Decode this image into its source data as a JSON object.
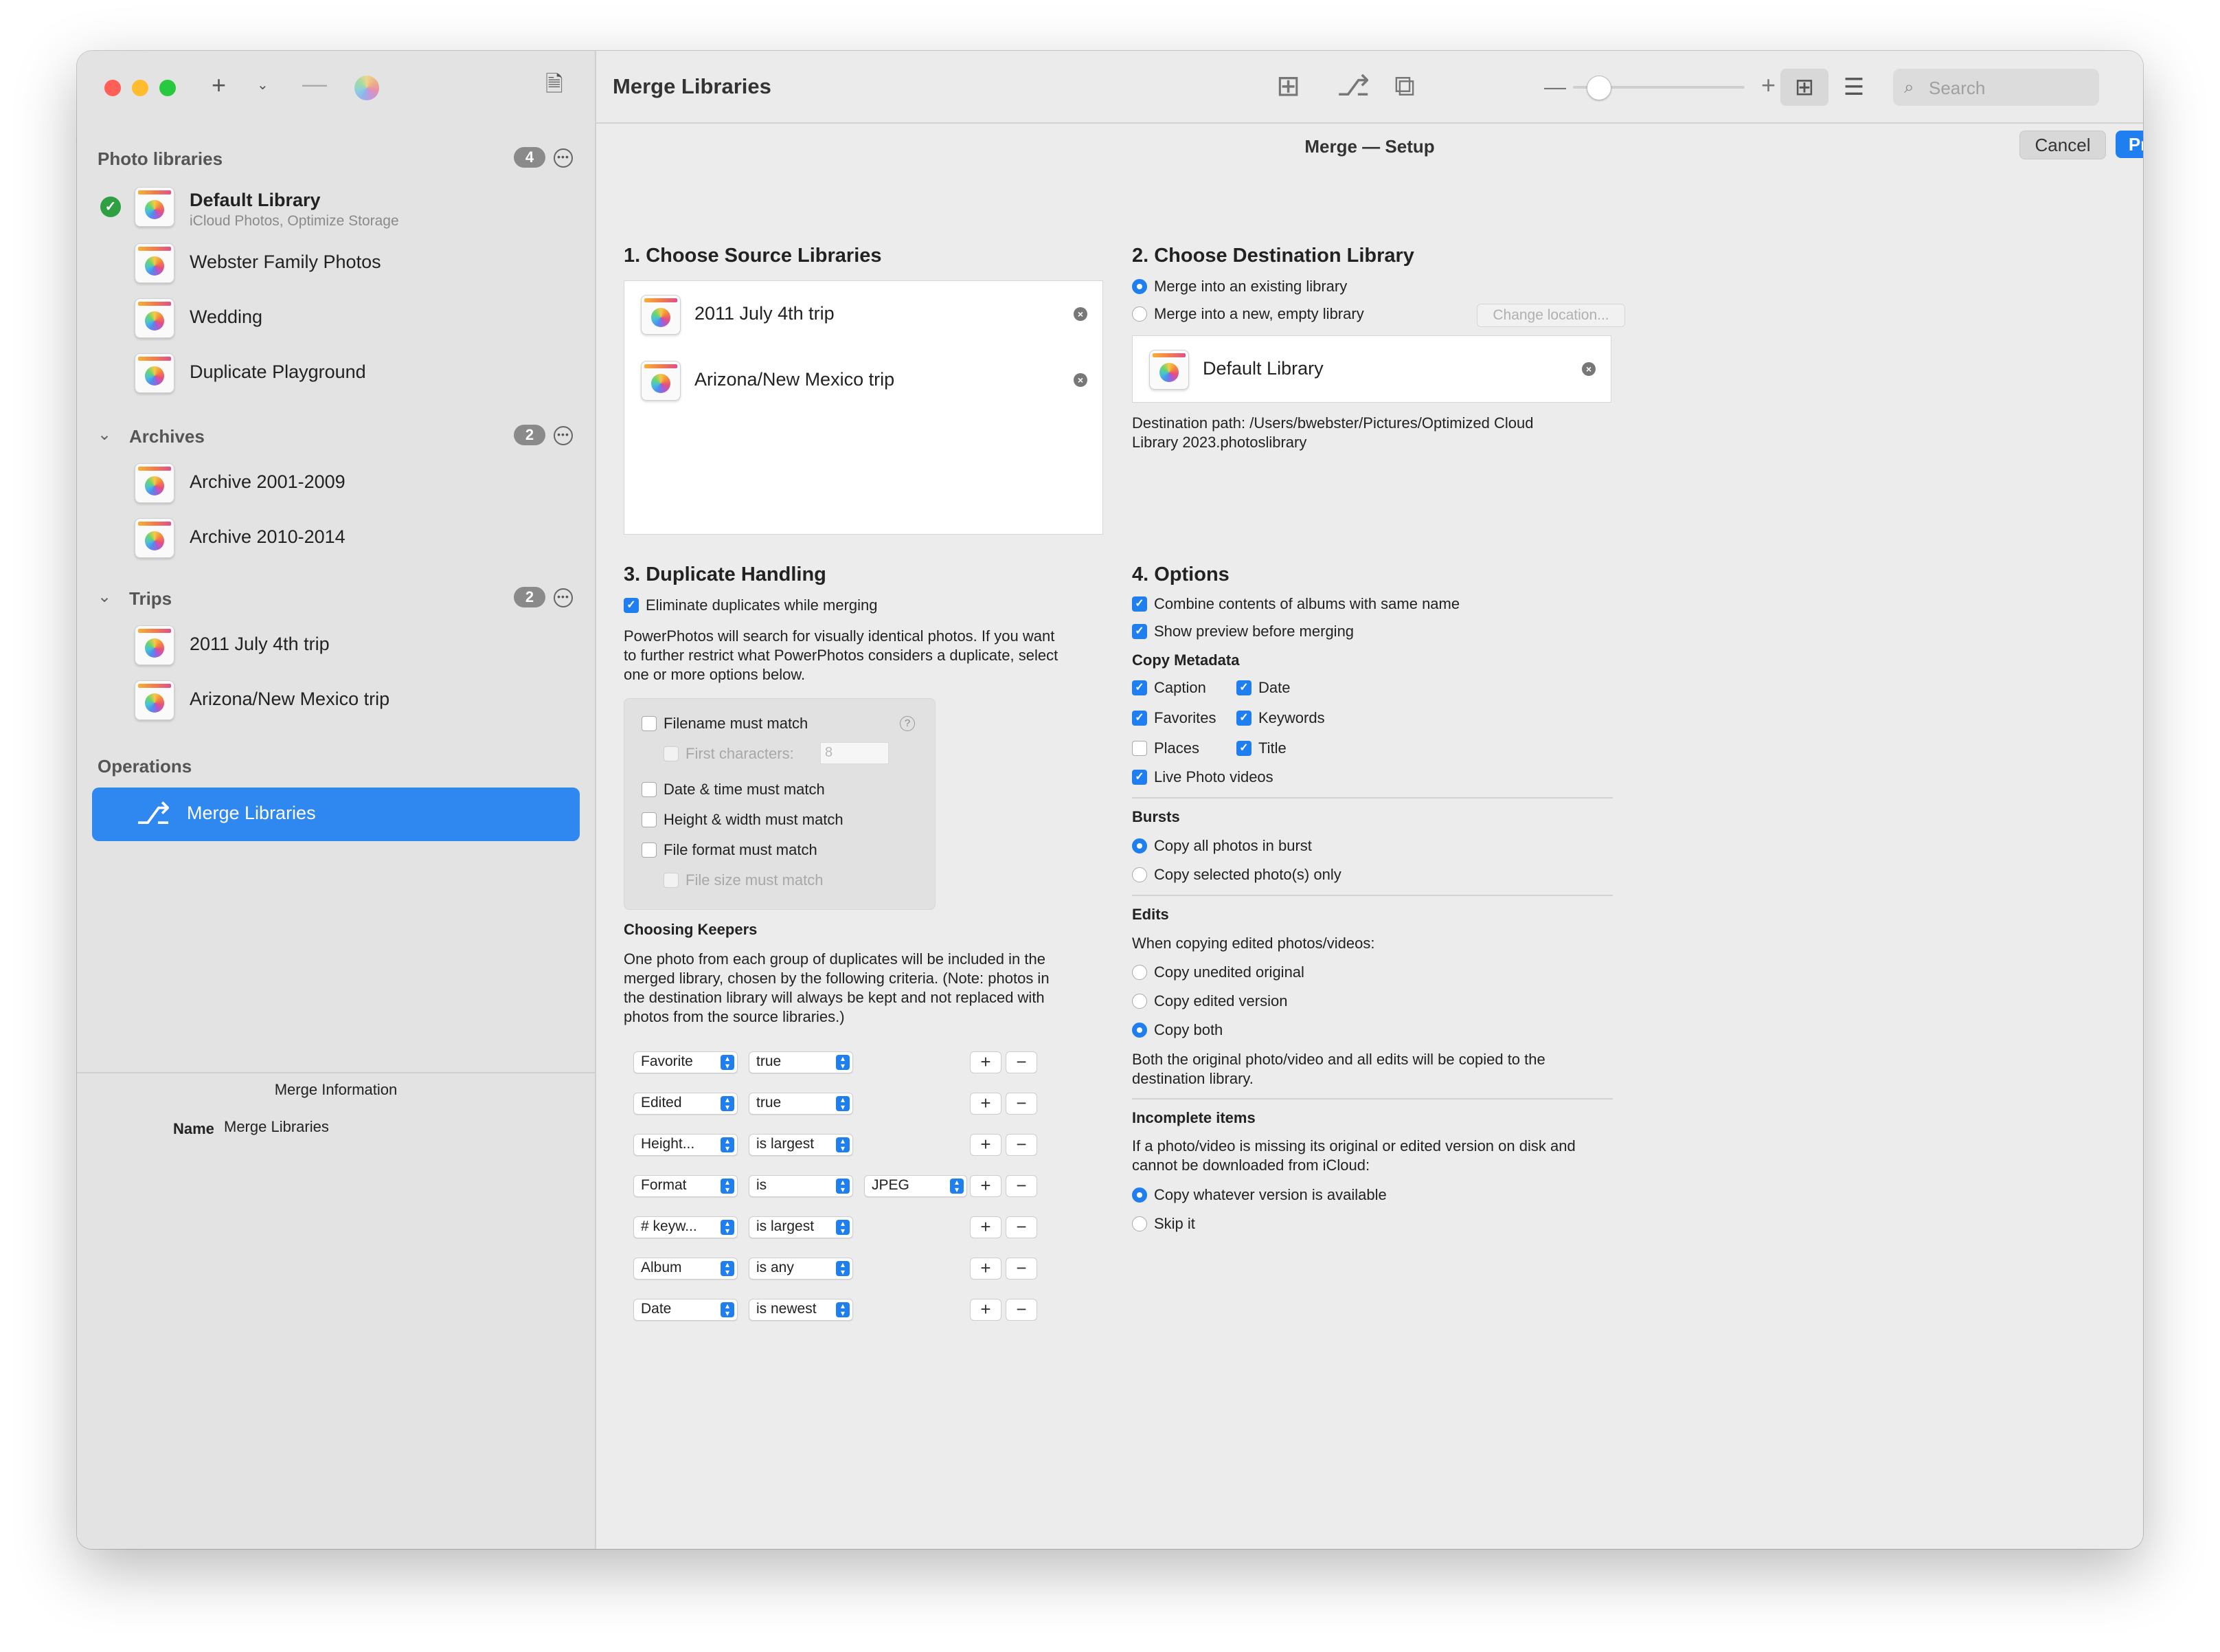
{
  "toolbar": {
    "title": "Merge Libraries",
    "search_placeholder": "Search"
  },
  "sidebar": {
    "photo_libraries": {
      "heading": "Photo libraries",
      "count": "4",
      "items": [
        {
          "name": "Default Library",
          "subtitle": "iCloud Photos, Optimize Storage",
          "active": true
        },
        {
          "name": "Webster Family Photos"
        },
        {
          "name": "Wedding"
        },
        {
          "name": "Duplicate Playground"
        }
      ]
    },
    "archives": {
      "heading": "Archives",
      "count": "2",
      "items": [
        {
          "name": "Archive 2001-2009"
        },
        {
          "name": "Archive 2010-2014"
        }
      ]
    },
    "trips": {
      "heading": "Trips",
      "count": "2",
      "items": [
        {
          "name": "2011 July 4th trip"
        },
        {
          "name": "Arizona/New Mexico trip"
        }
      ]
    },
    "operations": {
      "heading": "Operations",
      "selected": "Merge Libraries"
    },
    "merge_info": {
      "heading": "Merge Information",
      "name_label": "Name",
      "name_value": "Merge Libraries"
    }
  },
  "setup": {
    "title": "Merge — Setup",
    "cancel": "Cancel",
    "preview": "Preview",
    "source": {
      "heading": "1. Choose Source Libraries",
      "items": [
        "2011 July 4th trip",
        "Arizona/New Mexico trip"
      ]
    },
    "destination": {
      "heading": "2. Choose Destination Library",
      "option_existing": "Merge into an existing library",
      "option_new": "Merge into a new, empty library",
      "change_location": "Change location...",
      "selected_library": "Default Library",
      "path_label": "Destination path: /Users/bwebster/Pictures/Optimized Cloud",
      "path_label_2": "Library 2023.photoslibrary"
    },
    "duplicates": {
      "heading": "3. Duplicate Handling",
      "eliminate": "Eliminate duplicates while merging",
      "description_1": "PowerPhotos will search for visually identical photos. If you want",
      "description_2": "to further restrict what PowerPhotos considers a duplicate, select",
      "description_3": "one or more options below.",
      "filename": "Filename must match",
      "first_chars": "First characters:",
      "first_chars_value": "8",
      "datetime": "Date & time must match",
      "height_width": "Height & width must match",
      "file_format": "File format must match",
      "file_size": "File size must match",
      "keepers_heading": "Choosing Keepers",
      "keepers_1": "One photo from each group of duplicates will be included in the",
      "keepers_2": "merged library, chosen by the following criteria. (Note: photos in",
      "keepers_3": "the destination library will always be kept and not replaced with",
      "keepers_4": "photos from the source libraries.)",
      "criteria": [
        {
          "field": "Favorite",
          "op": "true",
          "extra": ""
        },
        {
          "field": "Edited",
          "op": "true",
          "extra": ""
        },
        {
          "field": "Height...",
          "op": "is largest",
          "extra": ""
        },
        {
          "field": "Format",
          "op": "is",
          "extra": "JPEG"
        },
        {
          "field": "# keyw...",
          "op": "is largest",
          "extra": ""
        },
        {
          "field": "Album",
          "op": "is any",
          "extra": ""
        },
        {
          "field": "Date",
          "op": "is newest",
          "extra": ""
        }
      ]
    },
    "options": {
      "heading": "4. Options",
      "combine_albums": "Combine contents of albums with same name",
      "show_preview": "Show preview before merging",
      "copy_metadata": "Copy Metadata",
      "caption": "Caption",
      "date": "Date",
      "favorites": "Favorites",
      "keywords": "Keywords",
      "places": "Places",
      "title": "Title",
      "live_photo": "Live Photo videos",
      "bursts_heading": "Bursts",
      "burst_all": "Copy all photos in burst",
      "burst_selected": "Copy selected photo(s) only",
      "edits_heading": "Edits",
      "edits_intro": "When copying edited photos/videos:",
      "edits_unedited": "Copy unedited original",
      "edits_edited": "Copy edited version",
      "edits_both": "Copy both",
      "edits_note_1": "Both the original photo/video and all edits will be copied to the",
      "edits_note_2": "destination library.",
      "incomplete_heading": "Incomplete items",
      "incomplete_1": "If a photo/video is missing its original or edited version on disk and",
      "incomplete_2": "cannot be downloaded from iCloud:",
      "incomplete_copy": "Copy whatever version is available",
      "incomplete_skip": "Skip it"
    }
  },
  "colors": {
    "accent": "#1f7ff0",
    "selected_row": "#2f87f0",
    "success": "#2ea043"
  }
}
